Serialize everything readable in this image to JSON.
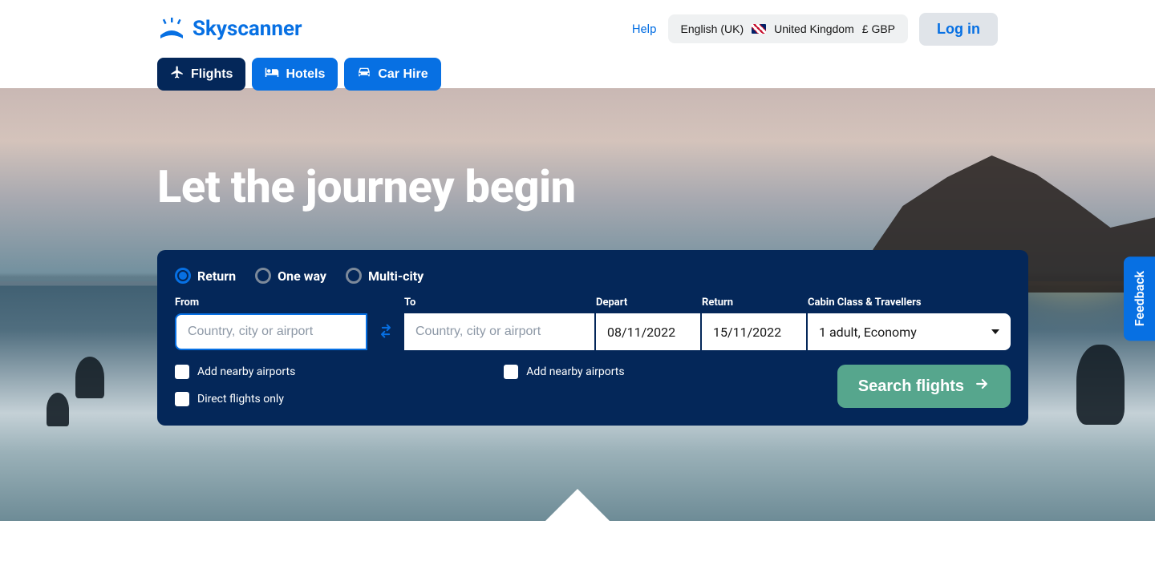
{
  "brand": "Skyscanner",
  "header": {
    "help": "Help",
    "language": "English (UK)",
    "country": "United Kingdom",
    "currency": "£ GBP",
    "login": "Log in"
  },
  "nav": {
    "flights": "Flights",
    "hotels": "Hotels",
    "carhire": "Car Hire"
  },
  "hero": {
    "title": "Let the journey begin"
  },
  "trip": {
    "return": "Return",
    "oneway": "One way",
    "multicity": "Multi-city"
  },
  "labels": {
    "from": "From",
    "to": "To",
    "depart": "Depart",
    "return": "Return",
    "cabin": "Cabin Class & Travellers"
  },
  "placeholders": {
    "from": "Country, city or airport",
    "to": "Country, city or airport"
  },
  "values": {
    "depart": "08/11/2022",
    "return": "15/11/2022",
    "cabin": "1 adult, Economy"
  },
  "checks": {
    "nearby_from": "Add nearby airports",
    "nearby_to": "Add nearby airports",
    "direct": "Direct flights only"
  },
  "search_button": "Search flights",
  "feedback": "Feedback"
}
